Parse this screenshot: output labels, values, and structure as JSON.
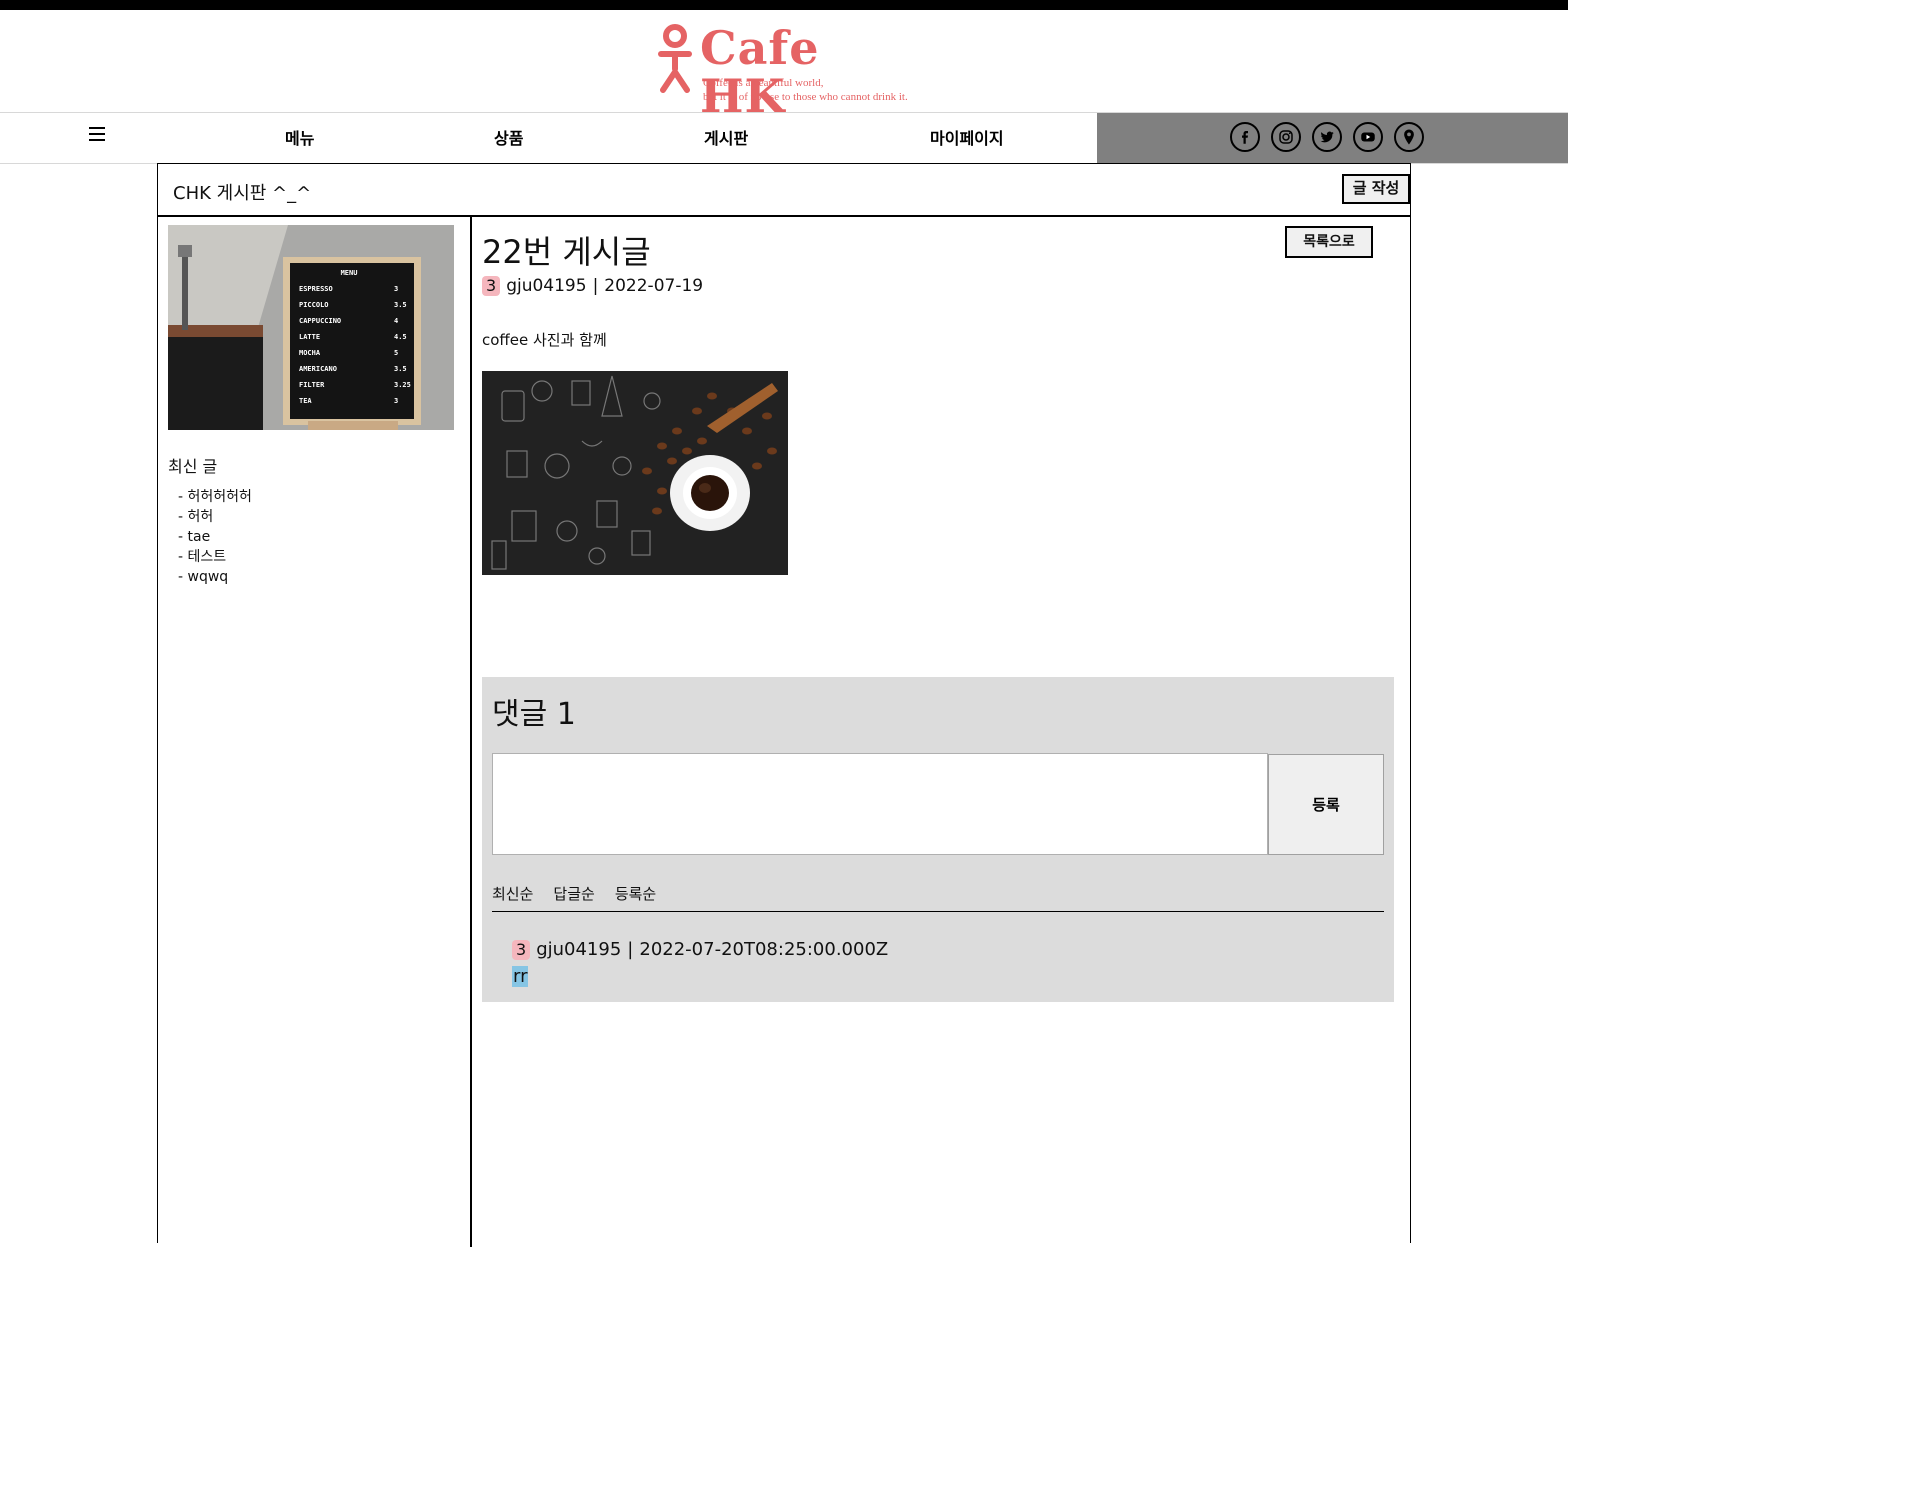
{
  "brand": {
    "name": "Cafe HK",
    "tagline_1": "Coffee is a beautiful world,",
    "tagline_2": "but it is of no use to those who cannot drink it.",
    "color": "#e56364"
  },
  "nav": {
    "items": [
      {
        "label": "메뉴"
      },
      {
        "label": "상품"
      },
      {
        "label": "게시판"
      },
      {
        "label": "마이페이지"
      }
    ],
    "social": [
      "facebook-icon",
      "instagram-icon",
      "twitter-icon",
      "youtube-icon",
      "location-icon"
    ]
  },
  "board": {
    "title": "CHK 게시판 ^_^",
    "write_label": "글 작성"
  },
  "sidebar": {
    "menu_board_title": "MENU",
    "menu_board_items": [
      {
        "name": "ESPRESSO",
        "price": "3"
      },
      {
        "name": "PICCOLO",
        "price": "3.5"
      },
      {
        "name": "CAPPUCCINO",
        "price": "4"
      },
      {
        "name": "LATTE",
        "price": "4.5"
      },
      {
        "name": "MOCHA",
        "price": "5"
      },
      {
        "name": "AMERICANO",
        "price": "3.5"
      },
      {
        "name": "FILTER",
        "price": "3.25"
      },
      {
        "name": "TEA",
        "price": "3"
      }
    ],
    "recent_title": "최신 글",
    "recent_posts": [
      "- 허허허허허",
      "- 허허",
      "- tae",
      "- 테스트",
      "- wqwq"
    ]
  },
  "post": {
    "title": "22번 게시글",
    "list_label": "목록으로",
    "badge": "3",
    "author": "gju04195",
    "separator": "|",
    "date": "2022-07-19",
    "body": "coffee 사진과 함께"
  },
  "comments": {
    "title": "댓글 1",
    "input_placeholder": "",
    "submit_label": "등록",
    "sort_options": [
      "최신순",
      "답글순",
      "등록순"
    ],
    "items": [
      {
        "badge": "3",
        "author": "gju04195",
        "separator": "|",
        "date": "2022-07-20T08:25:00.000Z",
        "text": "rr"
      }
    ]
  }
}
